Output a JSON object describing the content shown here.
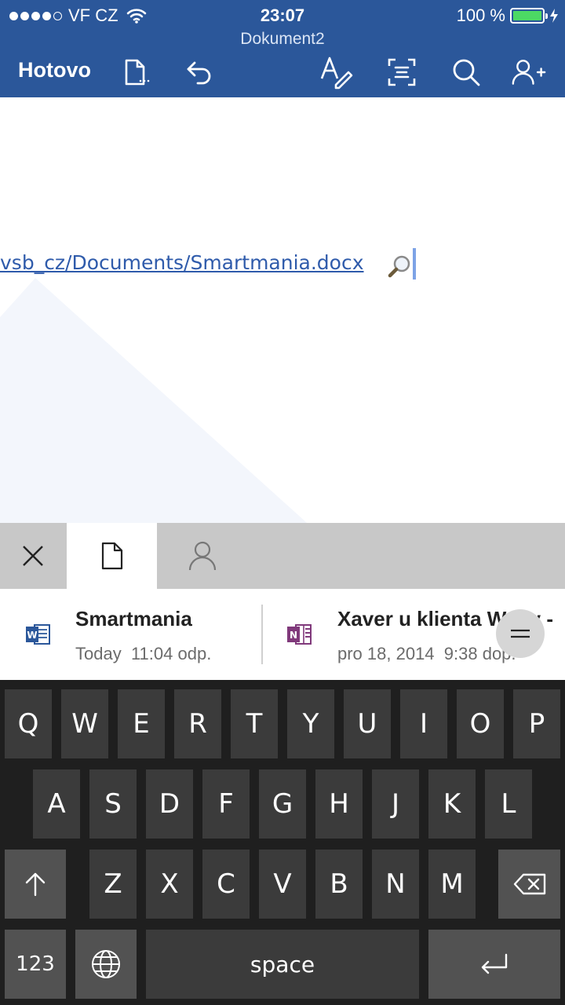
{
  "status_bar": {
    "carrier": "VF CZ",
    "time": "23:07",
    "battery_percent": "100 %",
    "battery_color": "#4cd964"
  },
  "header": {
    "document_title": "Dokument2",
    "done_label": "Hotovo",
    "background_color": "#2b579a"
  },
  "document": {
    "link_text": "vsb_cz/Documents/Smartmania.docx",
    "link_color": "#2f5bab"
  },
  "panel_tabs": {
    "icons": [
      "close-icon",
      "file-icon",
      "person-icon"
    ]
  },
  "suggestions": [
    {
      "title": "Smartmania",
      "date": "Today",
      "time": "11:04 odp.",
      "app_icon": "word-icon"
    },
    {
      "title": "Xaver u klienta Waby -",
      "date": "pro 18, 2014",
      "time": "9:38 dop.",
      "app_icon": "onenote-icon"
    }
  ],
  "keyboard": {
    "row1": [
      "Q",
      "W",
      "E",
      "R",
      "T",
      "Y",
      "U",
      "I",
      "O",
      "P"
    ],
    "row2": [
      "A",
      "S",
      "D",
      "F",
      "G",
      "H",
      "J",
      "K",
      "L"
    ],
    "row3": [
      "Z",
      "X",
      "C",
      "V",
      "B",
      "N",
      "M"
    ],
    "numbers_label": "123",
    "space_label": "space"
  }
}
